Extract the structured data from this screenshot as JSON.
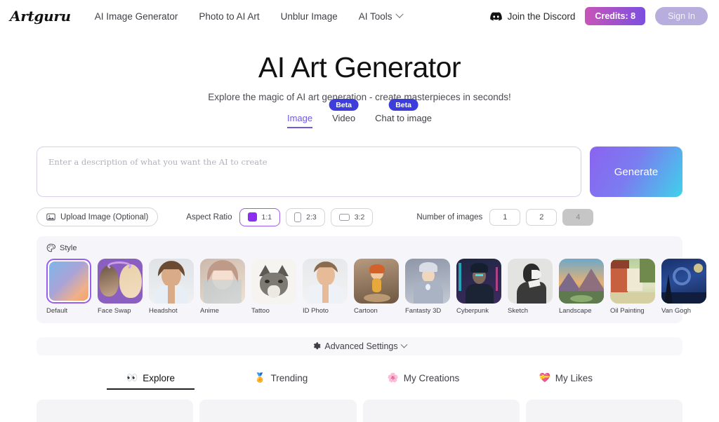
{
  "header": {
    "logo": "Artguru",
    "nav": [
      {
        "label": "AI Image Generator"
      },
      {
        "label": "Photo to AI Art"
      },
      {
        "label": "Unblur Image"
      },
      {
        "label": "AI Tools"
      }
    ],
    "discord_label": "Join the Discord",
    "discord_icon": "discord-icon",
    "credits_label": "Credits: 8",
    "signin_label": "Sign In",
    "credits_gradient_from": "#c855b8",
    "credits_gradient_to": "#7b4fe0",
    "signin_bg": "#b8aede"
  },
  "hero": {
    "title": "AI Art Generator",
    "subtitle": "Explore the magic of AI art generation - create masterpieces in seconds!"
  },
  "modes": [
    {
      "label": "Image",
      "badge": "",
      "active": true
    },
    {
      "label": "Video",
      "badge": "Beta",
      "active": false
    },
    {
      "label": "Chat to image",
      "badge": "Beta",
      "active": false
    }
  ],
  "mode_accent": "#6d5ae0",
  "badge_color": "#3d3ddb",
  "prompt": {
    "placeholder": "Enter a description of what you want the AI to create",
    "value": "",
    "generate_label": "Generate"
  },
  "options": {
    "upload_label": "Upload Image (Optional)",
    "upload_icon": "image-icon",
    "aspect_ratio_label": "Aspect Ratio",
    "ratios": [
      {
        "label": "1:1",
        "selected": true
      },
      {
        "label": "2:3",
        "selected": false
      },
      {
        "label": "3:2",
        "selected": false
      }
    ],
    "number_label": "Number of images",
    "counts": [
      {
        "label": "1",
        "selected": false
      },
      {
        "label": "2",
        "selected": false
      },
      {
        "label": "4",
        "selected": true
      }
    ],
    "selected_color": "#8b2ef0"
  },
  "style": {
    "section_label": "Style",
    "section_icon": "palette-icon",
    "items": [
      {
        "name": "Default",
        "selected": true
      },
      {
        "name": "Face Swap",
        "selected": false
      },
      {
        "name": "Headshot",
        "selected": false
      },
      {
        "name": "Anime",
        "selected": false
      },
      {
        "name": "Tattoo",
        "selected": false
      },
      {
        "name": "ID Photo",
        "selected": false
      },
      {
        "name": "Cartoon",
        "selected": false
      },
      {
        "name": "Fantasty 3D",
        "selected": false
      },
      {
        "name": "Cyberpunk",
        "selected": false
      },
      {
        "name": "Sketch",
        "selected": false
      },
      {
        "name": "Landscape",
        "selected": false
      },
      {
        "name": "Oil Painting",
        "selected": false
      },
      {
        "name": "Van Gogh",
        "selected": false
      }
    ]
  },
  "advanced": {
    "label": "Advanced Settings",
    "icon": "gear-icon",
    "chevron": "chevron-down-icon"
  },
  "bottom_tabs": [
    {
      "label": "Explore",
      "emoji": "👀",
      "active": true
    },
    {
      "label": "Trending",
      "emoji": "🏅",
      "active": false
    },
    {
      "label": "My Creations",
      "emoji": "🌸",
      "active": false
    },
    {
      "label": "My Likes",
      "emoji": "💝",
      "active": false
    }
  ],
  "gallery_placeholders": 4
}
